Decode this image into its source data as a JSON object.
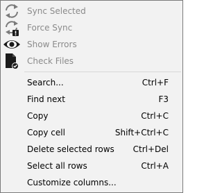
{
  "menu": {
    "items": [
      {
        "label": "Sync Selected",
        "shortcut": "",
        "enabled": false,
        "icon": "sync-icon"
      },
      {
        "label": "Force Sync",
        "shortcut": "",
        "enabled": false,
        "icon": "force-sync-icon"
      },
      {
        "label": "Show Errors",
        "shortcut": "",
        "enabled": false,
        "icon": "eye-icon"
      },
      {
        "label": "Check Files",
        "shortcut": "",
        "enabled": false,
        "icon": "file-check-icon"
      },
      {
        "label": "Search...",
        "shortcut": "Ctrl+F",
        "enabled": true
      },
      {
        "label": "Find next",
        "shortcut": "F3",
        "enabled": true
      },
      {
        "label": "Copy",
        "shortcut": "Ctrl+C",
        "enabled": true
      },
      {
        "label": "Copy cell",
        "shortcut": "Shift+Ctrl+C",
        "enabled": true
      },
      {
        "label": "Delete selected rows",
        "shortcut": "Ctrl+Del",
        "enabled": true
      },
      {
        "label": "Select all rows",
        "shortcut": "Ctrl+A",
        "enabled": true
      },
      {
        "label": "Customize columns...",
        "shortcut": "",
        "enabled": true
      }
    ]
  },
  "colors": {
    "background": "#f2f2f2",
    "border": "#7a7a7a",
    "disabled_text": "#8a8a8a",
    "icon": "#1a1a1a"
  }
}
